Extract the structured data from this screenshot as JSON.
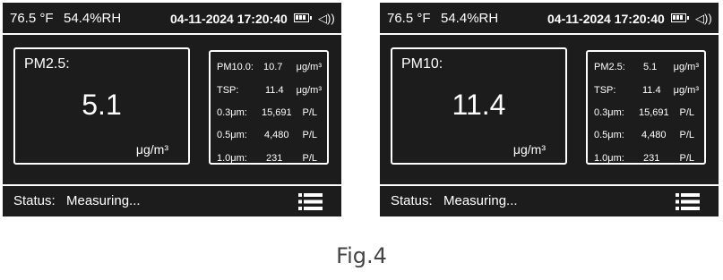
{
  "screens": [
    {
      "topbar": {
        "temperature": "76.5 °F",
        "humidity": "54.4%RH",
        "datetime": "04-11-2024 17:20:40",
        "battery_icon": "battery-icon",
        "speaker_icon": "speaker-icon",
        "speaker_glyph": "◁))"
      },
      "main": {
        "label": "PM2.5:",
        "value": "5.1",
        "unit": "μg/m³"
      },
      "side": [
        {
          "label": "PM10.0:",
          "value": "10.7",
          "unit": "μg/m³"
        },
        {
          "label": "TSP:",
          "value": "11.4",
          "unit": "μg/m³"
        },
        {
          "label": "0.3μm:",
          "value": "15,691",
          "unit": "P/L"
        },
        {
          "label": "0.5μm:",
          "value": "4,480",
          "unit": "P/L"
        },
        {
          "label": "1.0μm:",
          "value": "231",
          "unit": "P/L"
        }
      ],
      "status": {
        "label": "Status:",
        "value": "Measuring...",
        "menu_icon": "menu-icon"
      }
    },
    {
      "topbar": {
        "temperature": "76.5 °F",
        "humidity": "54.4%RH",
        "datetime": "04-11-2024 17:20:40",
        "battery_icon": "battery-icon",
        "speaker_icon": "speaker-icon",
        "speaker_glyph": "◁))"
      },
      "main": {
        "label": "PM10:",
        "value": "11.4",
        "unit": "μg/m³"
      },
      "side": [
        {
          "label": "PM2.5:",
          "value": "5.1",
          "unit": "μg/m³"
        },
        {
          "label": "TSP:",
          "value": "11.4",
          "unit": "μg/m³"
        },
        {
          "label": "0.3μm:",
          "value": "15,691",
          "unit": "P/L"
        },
        {
          "label": "0.5μm:",
          "value": "4,480",
          "unit": "P/L"
        },
        {
          "label": "1.0μm:",
          "value": "231",
          "unit": "P/L"
        }
      ],
      "status": {
        "label": "Status:",
        "value": "Measuring...",
        "menu_icon": "menu-icon"
      }
    }
  ],
  "caption": "Fig.4",
  "colors": {
    "screen_background": "#1c1c1c",
    "foreground": "#ffffff",
    "caption": "#444444"
  }
}
